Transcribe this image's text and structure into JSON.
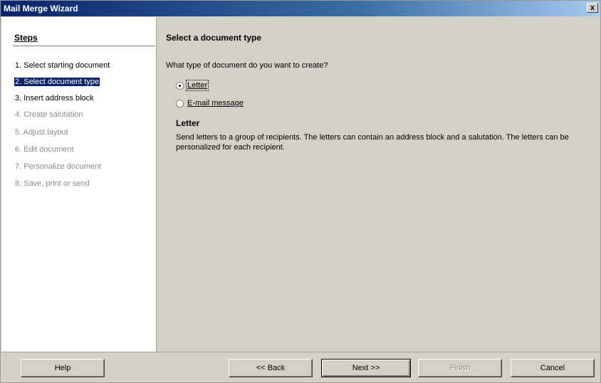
{
  "window": {
    "title": "Mail Merge Wizard",
    "close_label": "x"
  },
  "steps": {
    "heading": "Steps",
    "items": [
      {
        "label": "1. Select starting document",
        "state": "active"
      },
      {
        "label": "2. Select document type",
        "state": "current"
      },
      {
        "label": "3. Insert address block",
        "state": "active"
      },
      {
        "label": "4. Create salutation",
        "state": "disabled"
      },
      {
        "label": "5. Adjust layout",
        "state": "disabled"
      },
      {
        "label": "6. Edit document",
        "state": "disabled"
      },
      {
        "label": "7. Personalize document",
        "state": "disabled"
      },
      {
        "label": "8. Save, print or send",
        "state": "disabled"
      }
    ]
  },
  "main": {
    "heading": "Select a document type",
    "question": "What type of document do you want to create?",
    "options": [
      {
        "label": "Letter",
        "checked": true
      },
      {
        "label": "E-mail message",
        "checked": false
      }
    ],
    "description_title": "Letter",
    "description_text": "Send letters to a group of recipients. The letters can contain an address block and a salutation. The letters can be personalized for each recipient."
  },
  "buttons": {
    "help": "Help",
    "back": "<< Back",
    "next": "Next >>",
    "finish": "Finish",
    "cancel": "Cancel"
  },
  "colors": {
    "highlight": "#0a246a",
    "face": "#d4d0c8",
    "disabled_text": "#8a8a8a"
  }
}
